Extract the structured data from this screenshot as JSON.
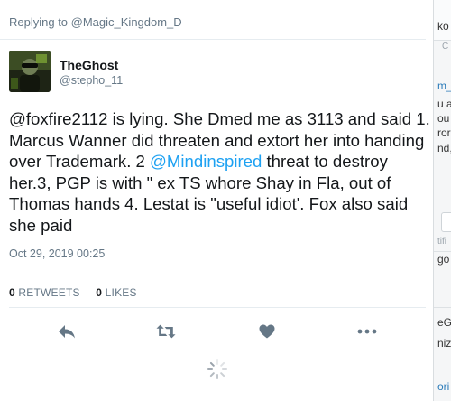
{
  "tweet": {
    "replying_to": "Replying to @Magic_Kingdom_D",
    "author": {
      "name": "TheGhost",
      "handle": "@stepho_11"
    },
    "text": {
      "part1": "@foxfire2112 is lying. She Dmed me as 3113 and said 1. Marcus Wanner did threaten and extort her into handing over Trademark. 2 ",
      "mention": "@Mindinspired",
      "part2": " threat to destroy her.3, PGP is with \" ex TS whore Shay in Fla, out of Thomas hands 4. Lestat is \"useful idiot'. Fox also said she paid"
    },
    "timestamp": "Oct 29, 2019 00:25",
    "stats": {
      "retweets_count": "0",
      "retweets_label": "RETWEETS",
      "likes_count": "0",
      "likes_label": "LIKES"
    }
  },
  "actions": {
    "icons": [
      "reply-icon",
      "retweet-icon",
      "like-icon",
      "more-icon"
    ]
  },
  "colors": {
    "link": "#1da1f2",
    "secondary_text": "#657786",
    "icon": "#657786",
    "divider": "#e6ecf0"
  },
  "background_window": {
    "fragments": [
      "ko",
      "C",
      "m_",
      "u a",
      "ou",
      "ror",
      "nd,",
      "tifi",
      "go",
      "eG",
      "niz",
      "ori"
    ]
  }
}
